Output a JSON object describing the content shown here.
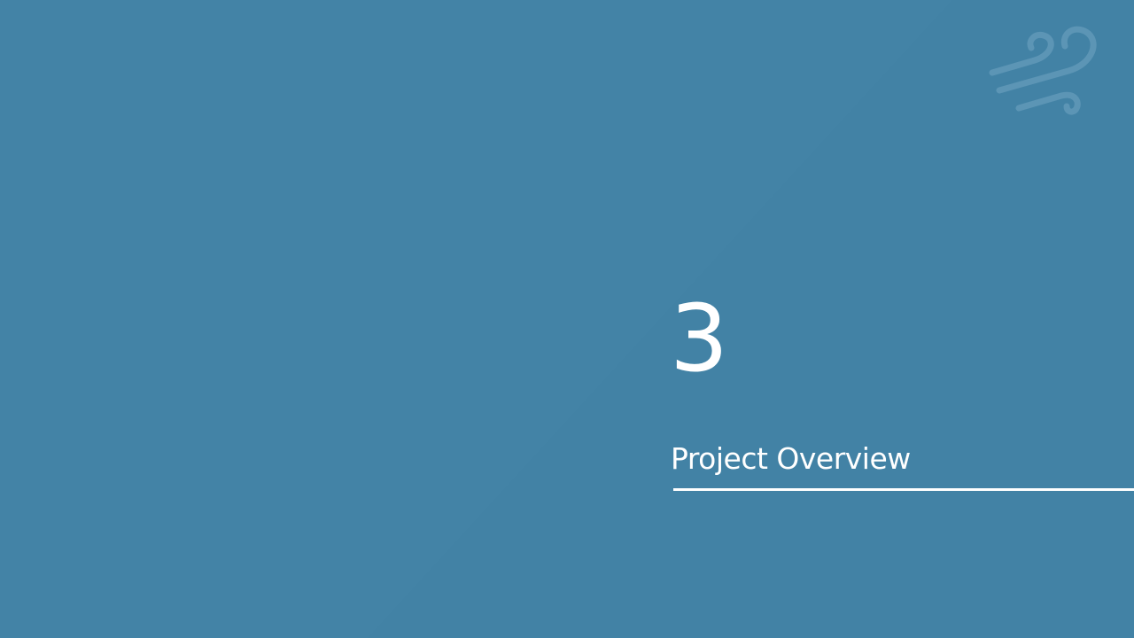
{
  "slide": {
    "section_number": "3",
    "section_title": "Project Overview"
  },
  "logo": {
    "icon": "wind-icon"
  },
  "colors": {
    "background": "#4383a6",
    "text": "#ffffff",
    "logo": "#6fa3c4"
  }
}
